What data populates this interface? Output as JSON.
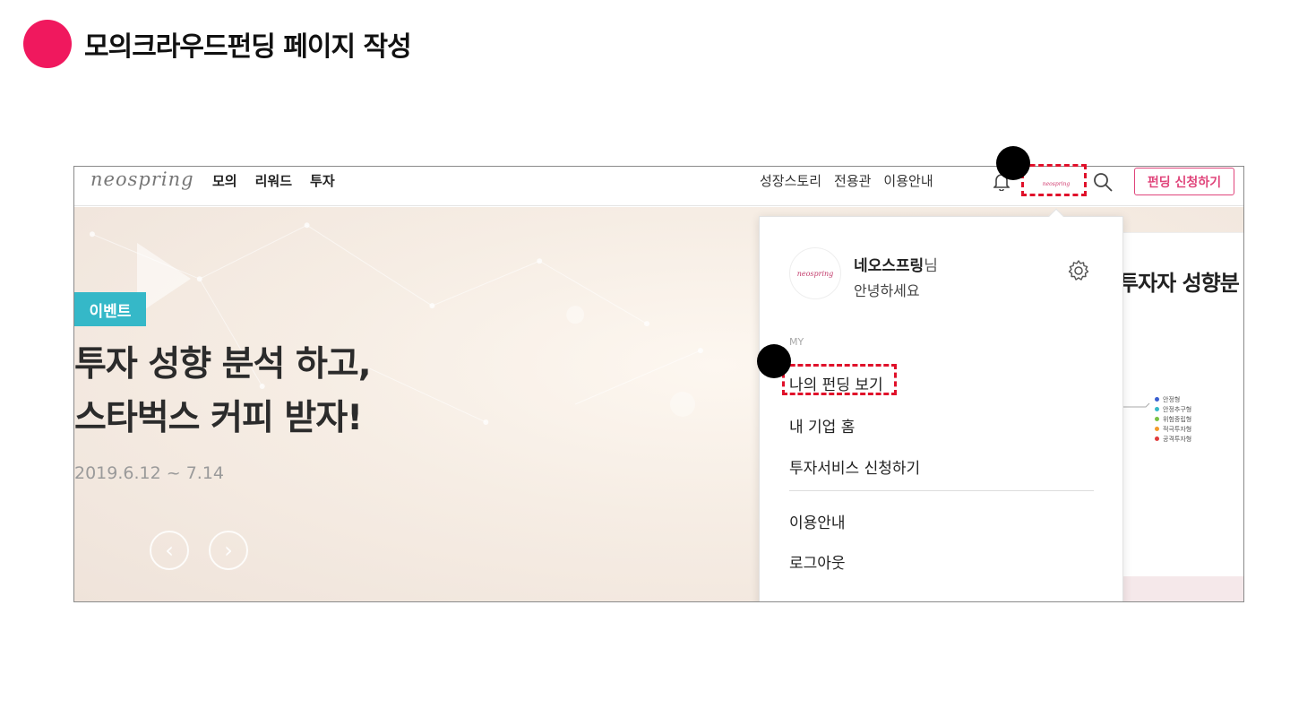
{
  "slide": {
    "title": "모의크라우드펀딩 페이지 작성"
  },
  "nav": {
    "logo": "neospring",
    "left_menu": [
      "모의",
      "리워드",
      "투자"
    ],
    "right_menu": [
      "성장스토리",
      "전용관",
      "이용안내"
    ],
    "profile_logo": "neospring",
    "apply_button": "펀딩 신청하기"
  },
  "hero": {
    "badge": "이벤트",
    "headline_line1": "투자 성향 분석 하고,",
    "headline_line2": "스타벅스 커피 받자!",
    "date": "2019.6.12 ~ 7.14",
    "prev_arrow": "‹",
    "next_arrow": "›"
  },
  "side_banner": {
    "title": "투자자 성향분",
    "legend": [
      {
        "label": "안정형",
        "color": "#3a5fd0"
      },
      {
        "label": "안정추구형",
        "color": "#35b8c8"
      },
      {
        "label": "위험중립형",
        "color": "#7ac143"
      },
      {
        "label": "적극투자형",
        "color": "#f39a2b"
      },
      {
        "label": "공격투자형",
        "color": "#e03b3b"
      }
    ]
  },
  "dropdown": {
    "avatar_logo": "neospring",
    "user_name": "네오스프링",
    "user_suffix": "님",
    "greeting": "안녕하세요",
    "section_label": "MY",
    "items": [
      "나의 펀딩 보기",
      "내 기업 홈",
      "투자서비스 신청하기",
      "이용안내",
      "로그아웃"
    ]
  },
  "colors": {
    "accent": "#f0185e",
    "brand_pink": "#e0457b",
    "badge": "#35b8c8",
    "annotation_red": "#e0102a"
  }
}
